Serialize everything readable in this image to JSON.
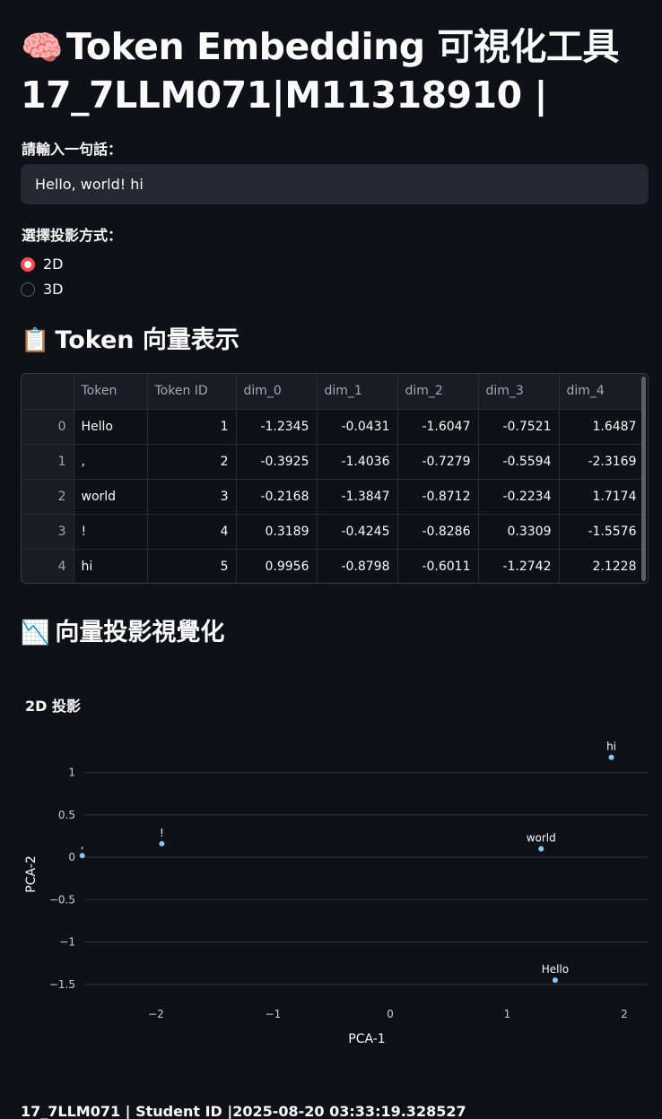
{
  "header": {
    "icon": "🧠",
    "title_line1": "Token Embedding 可視化工具",
    "title_line2": "17_7LLM071|M11318910 |"
  },
  "input": {
    "label": "請輸入一句話：",
    "value": "Hello, world! hi"
  },
  "projection": {
    "label": "選擇投影方式：",
    "options": [
      {
        "label": "2D",
        "selected": true
      },
      {
        "label": "3D",
        "selected": false
      }
    ]
  },
  "table_section": {
    "icon": "📋",
    "title": "Token 向量表示",
    "columns": [
      "",
      "Token",
      "Token ID",
      "dim_0",
      "dim_1",
      "dim_2",
      "dim_3",
      "dim_4"
    ],
    "rows": [
      {
        "index": "0",
        "token": "Hello",
        "token_id": "1",
        "dims": [
          "-1.2345",
          "-0.0431",
          "-1.6047",
          "-0.7521",
          "1.6487"
        ]
      },
      {
        "index": "1",
        "token": ",",
        "token_id": "2",
        "dims": [
          "-0.3925",
          "-1.4036",
          "-0.7279",
          "-0.5594",
          "-2.3169"
        ]
      },
      {
        "index": "2",
        "token": "world",
        "token_id": "3",
        "dims": [
          "-0.2168",
          "-1.3847",
          "-0.8712",
          "-0.2234",
          "1.7174"
        ]
      },
      {
        "index": "3",
        "token": "!",
        "token_id": "4",
        "dims": [
          "0.3189",
          "-0.4245",
          "-0.8286",
          "0.3309",
          "-1.5576"
        ]
      },
      {
        "index": "4",
        "token": "hi",
        "token_id": "5",
        "dims": [
          "0.9956",
          "-0.8798",
          "-0.6011",
          "-1.2742",
          "2.1228"
        ]
      }
    ]
  },
  "viz_section": {
    "icon": "📉",
    "title": "向量投影視覺化"
  },
  "chart_data": {
    "type": "scatter",
    "title": "2D 投影",
    "xlabel": "PCA-1",
    "ylabel": "PCA-2",
    "xlim": [
      -2.75,
      2.2
    ],
    "ylim": [
      -1.65,
      1.25
    ],
    "xticks": [
      -2,
      -1,
      0,
      1,
      2
    ],
    "yticks": [
      1,
      0.5,
      0,
      -0.5,
      -1,
      -1.5
    ],
    "ytick_labels": [
      "1",
      "0.5",
      "0",
      "−0.5",
      "−1",
      "−1.5"
    ],
    "xtick_labels": [
      "−2",
      "−1",
      "0",
      "1",
      "2"
    ],
    "grid": "horizontal",
    "point_color": "#83c9ff",
    "points": [
      {
        "label": "Hello",
        "x": 1.41,
        "y": -1.45
      },
      {
        "label": ",",
        "x": -2.63,
        "y": 0.02
      },
      {
        "label": "world",
        "x": 1.29,
        "y": 0.1
      },
      {
        "label": "!",
        "x": -1.95,
        "y": 0.16
      },
      {
        "label": "hi",
        "x": 1.89,
        "y": 1.18
      }
    ]
  },
  "footer": {
    "text": "17_7LLM071 | Student ID |2025-08-20 03:33:19.328527"
  }
}
